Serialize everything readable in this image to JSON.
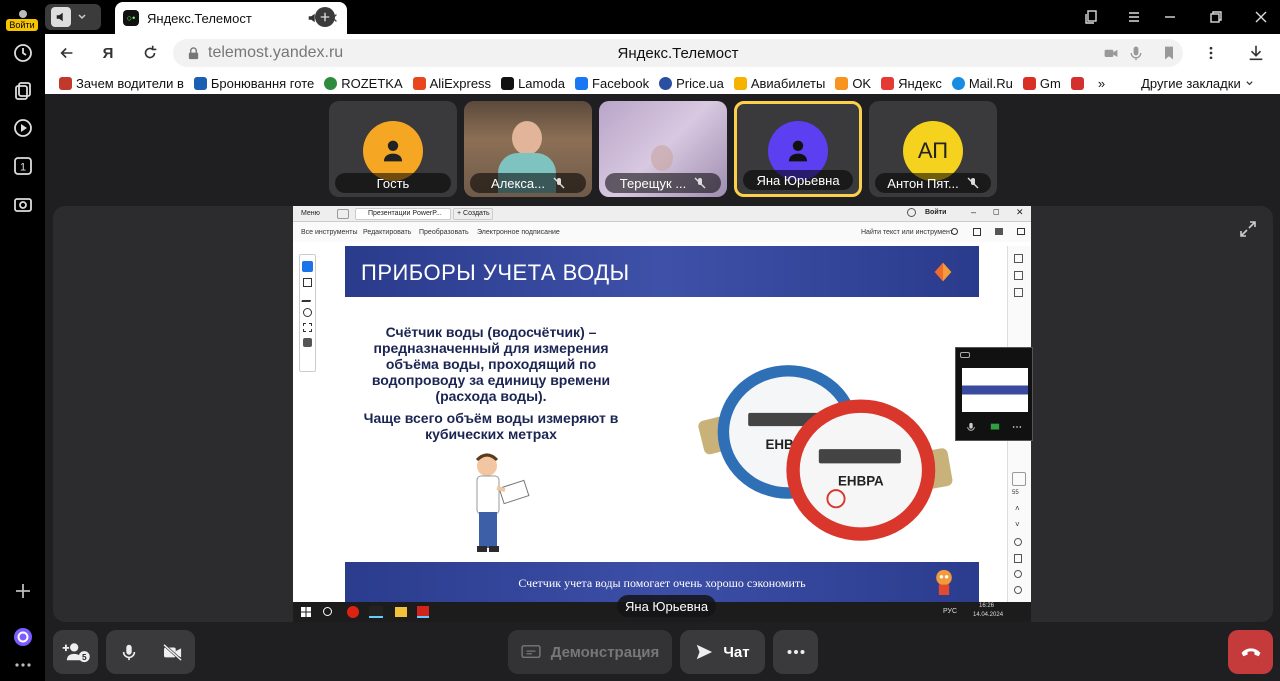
{
  "browser": {
    "login_label": "Войти",
    "tab_title": "Яндекс.Телемост",
    "url": "telemost.yandex.ru",
    "page_title": "Яндекс.Телемост",
    "yandex_button": "Я"
  },
  "bookmarks": [
    {
      "label": "Зачем водители в",
      "color": "#c0392b"
    },
    {
      "label": "Бронювання готе",
      "color": "#1b5fb3"
    },
    {
      "label": "ROZETKA",
      "color": "#2e8b3d"
    },
    {
      "label": "AliExpress",
      "color": "#e8471e"
    },
    {
      "label": "Lamoda",
      "color": "#111111"
    },
    {
      "label": "Facebook",
      "color": "#1877f2"
    },
    {
      "label": "Price.ua",
      "color": "#2a4fa0"
    },
    {
      "label": "Авиабилеты",
      "color": "#f5b300"
    },
    {
      "label": "OK",
      "color": "#f7931e"
    },
    {
      "label": "Яндекс",
      "color": "#e53935"
    },
    {
      "label": "Mail.Ru",
      "color": "#168de2"
    },
    {
      "label": "Gm",
      "color": "#d93025"
    }
  ],
  "bookmarks_more": "»",
  "bookmarks_other": "Другие закладки",
  "participants": [
    {
      "name": "Гость",
      "initials": "",
      "avatar_color": "#f5a623",
      "muted": false,
      "video": false
    },
    {
      "name": "Алекса...",
      "initials": "",
      "avatar_color": "",
      "muted": true,
      "video": true
    },
    {
      "name": "Терещук ...",
      "initials": "",
      "avatar_color": "",
      "muted": true,
      "video": true
    },
    {
      "name": "Яна Юрьевна",
      "initials": "",
      "avatar_color": "#5b3ff0",
      "muted": false,
      "video": false,
      "active": true
    },
    {
      "name": "Антон Пят...",
      "initials": "АП",
      "avatar_color": "#f5d21e",
      "muted": true,
      "video": false
    }
  ],
  "share": {
    "acrobat_tabs": [
      "Меню",
      "Презентации PowerP...",
      "+ Создать"
    ],
    "acrobat_signin": "Войти",
    "acrobat_tools": [
      "Все инструменты",
      "Редактировать",
      "Преобразовать",
      "Электронное подписание"
    ],
    "acrobat_search": "Найти текст или инструмент",
    "slide_title": "ПРИБОРЫ УЧЕТА ВОДЫ",
    "slide_paragraph": "Счётчик воды (водосчётчик) – предназначенный для измерения объёма воды, проходящий по водопроводу за единицу времени (расхода воды).",
    "slide_paragraph2": "Чаще всего объём воды измеряют в кубических метрах",
    "meter_brand": "ЕНВРА",
    "footer": "Счетчик учета воды помогает очень хорошо сэкономить",
    "zoom_value": "55",
    "clock_time": "16:26",
    "clock_date": "14.04.2024",
    "tray_lang": "РУС"
  },
  "presenter_name": "Яна Юрьевна",
  "controls": {
    "participants_count": "5",
    "demo_label": "Демонстрация",
    "chat_label": "Чат"
  }
}
